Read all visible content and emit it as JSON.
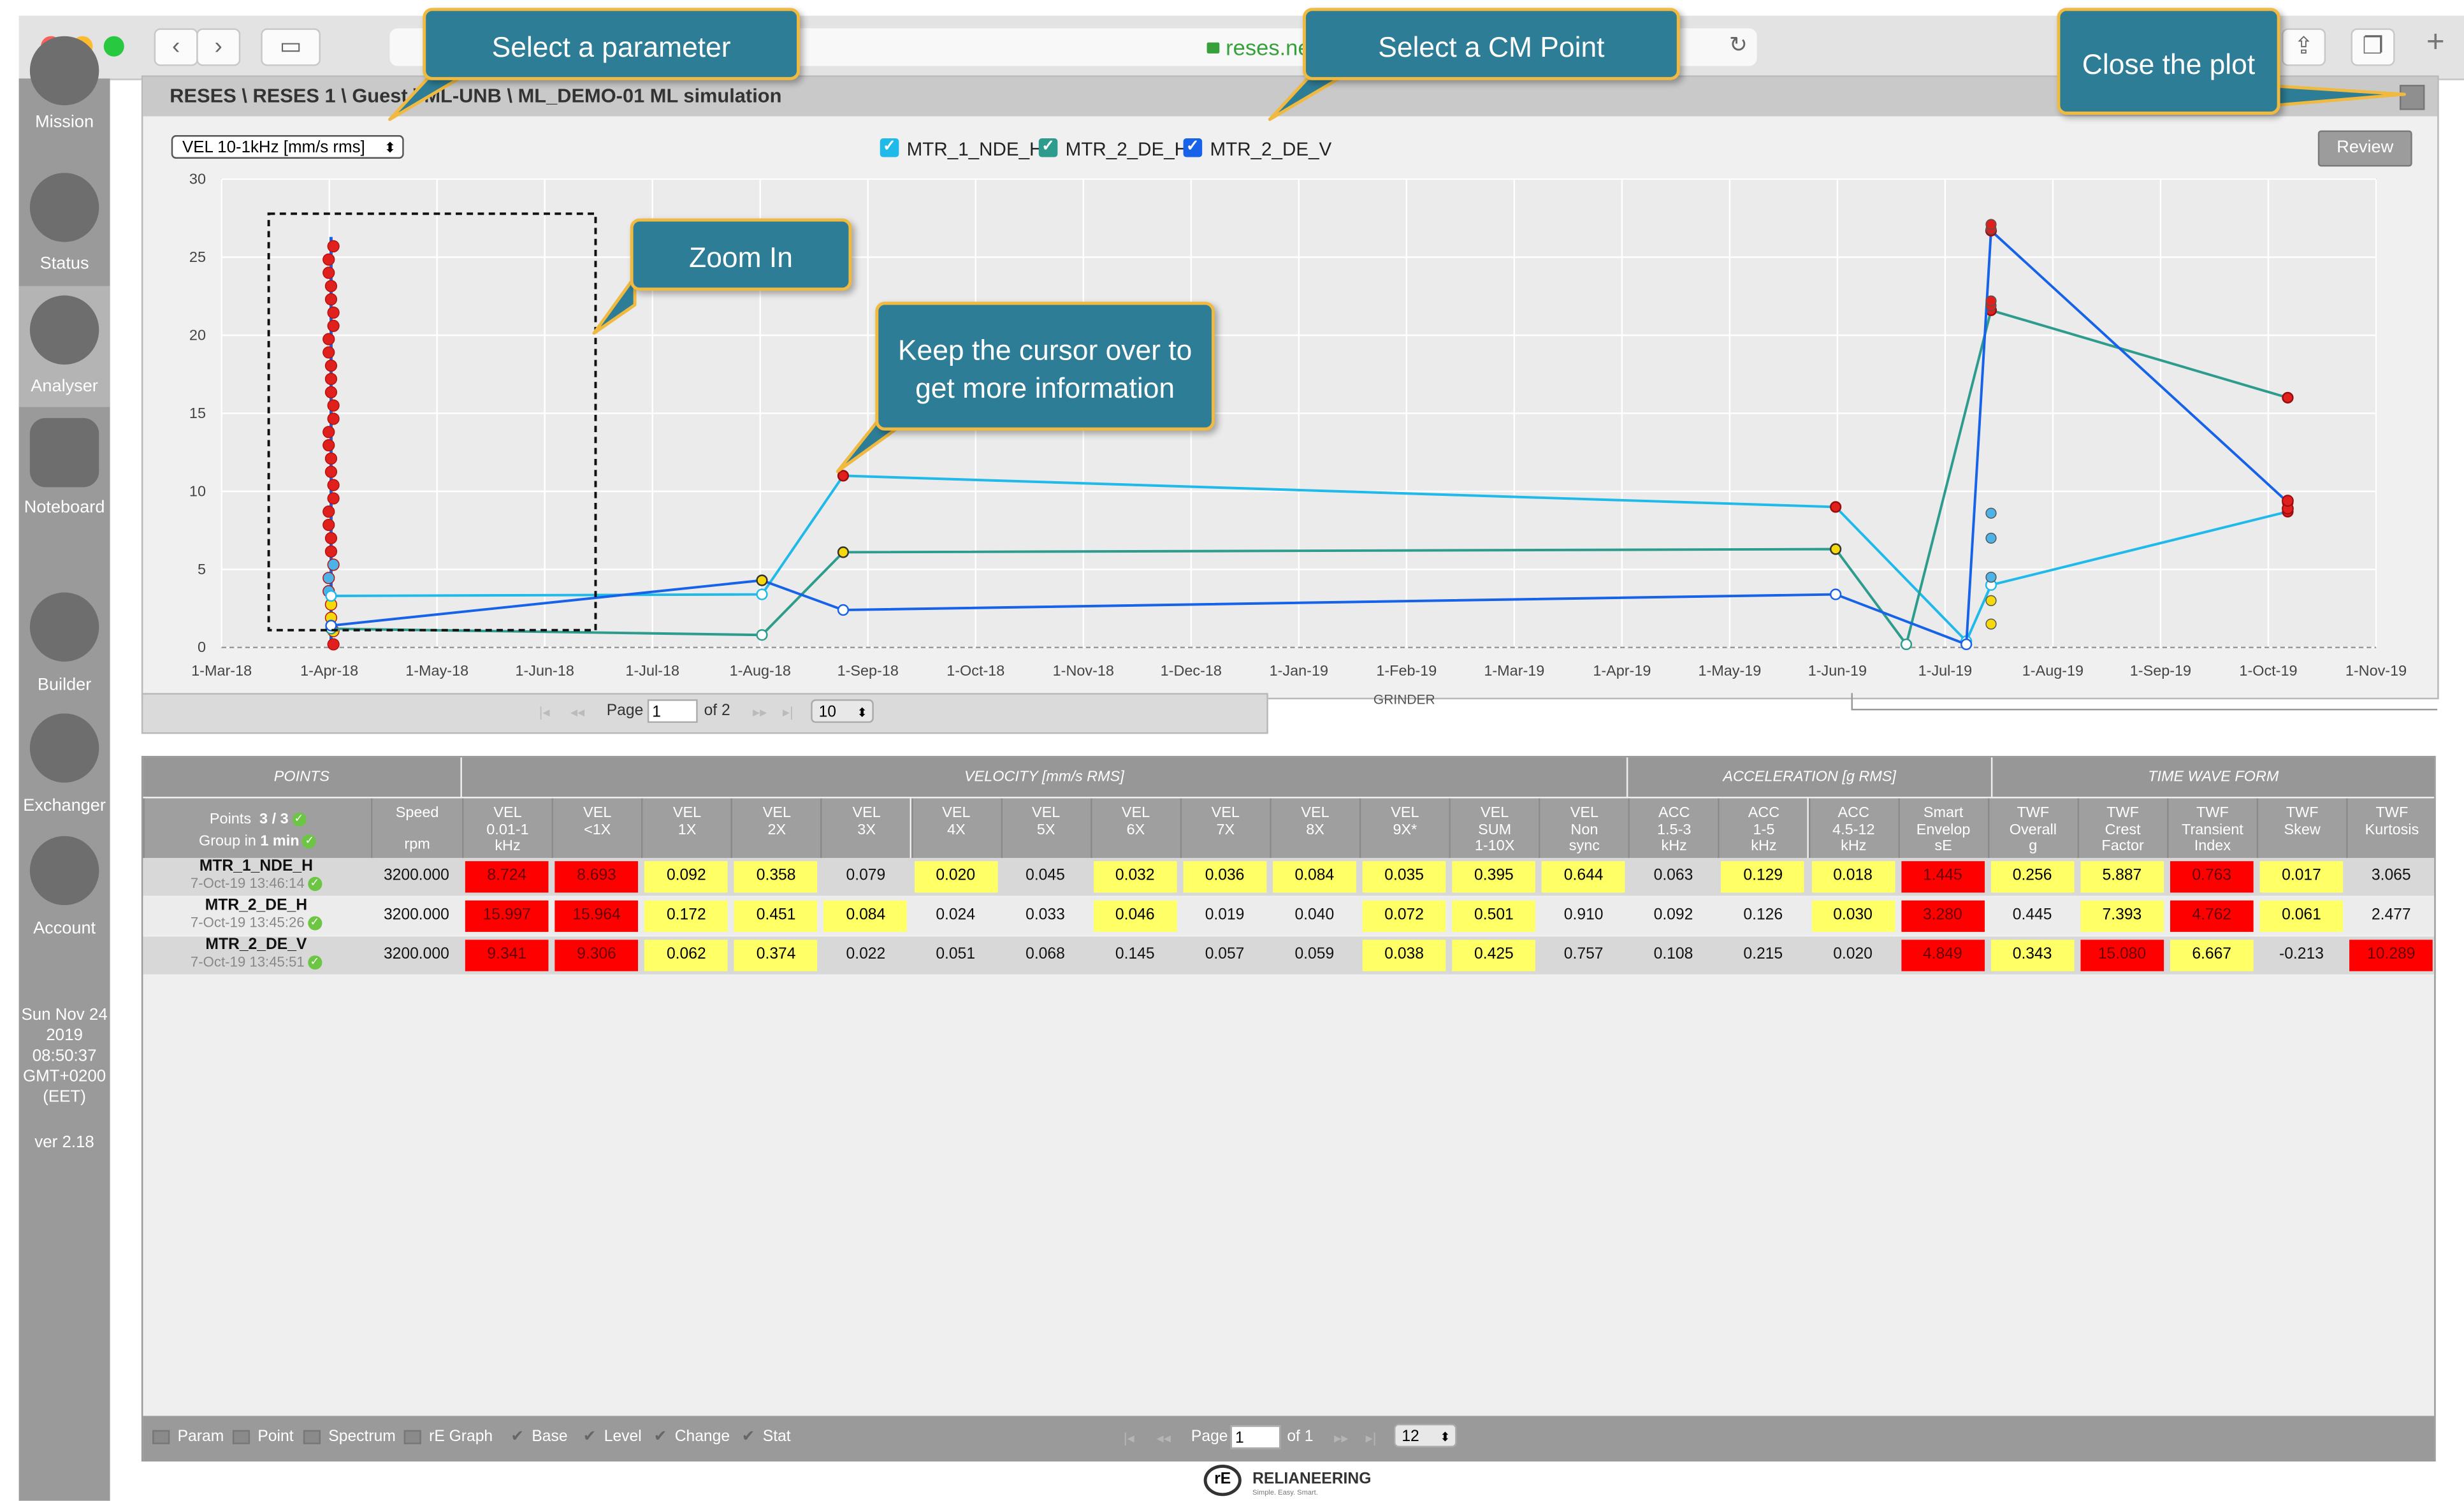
{
  "browser": {
    "url": "reses.net"
  },
  "sidebar": {
    "items": [
      {
        "label": "Mission"
      },
      {
        "label": "Status"
      },
      {
        "label": "Analyser"
      },
      {
        "label": "Noteboard"
      },
      {
        "label": "Builder"
      },
      {
        "label": "Exchanger"
      },
      {
        "label": "Account"
      }
    ],
    "date_lines": [
      "Sun Nov 24",
      "2019",
      "08:50:37",
      "GMT+0200",
      "(EET)"
    ],
    "version": "ver 2.18"
  },
  "panel": {
    "title": "RESES \\ RESES 1 \\ Guest \\ ML-UNB \\ ML_DEMO-01 ML simulation",
    "parameter": "VEL 10-1kHz [mm/s rms]",
    "review_label": "Review",
    "legend": [
      {
        "name": "MTR_1_NDE_H",
        "color": "#1fb9ea"
      },
      {
        "name": "MTR_2_DE_H",
        "color": "#2e9c8c"
      },
      {
        "name": "MTR_2_DE_V",
        "color": "#1662e8"
      }
    ],
    "footer_label": "GRINDER",
    "pager": {
      "page_label": "Page",
      "page": "1",
      "of_label": "of 2",
      "page_size": "10"
    }
  },
  "chart_data": {
    "type": "line",
    "title": "",
    "xlabel": "",
    "ylabel": "",
    "x_ticks": [
      "1-Mar-18",
      "1-Apr-18",
      "1-May-18",
      "1-Jun-18",
      "1-Jul-18",
      "1-Aug-18",
      "1-Sep-18",
      "1-Oct-18",
      "1-Nov-18",
      "1-Dec-18",
      "1-Jan-19",
      "1-Feb-19",
      "1-Mar-19",
      "1-Apr-19",
      "1-May-19",
      "1-Jun-19",
      "1-Jul-19",
      "1-Aug-19",
      "1-Sep-19",
      "1-Oct-19",
      "1-Nov-19"
    ],
    "y_ticks": [
      0,
      5,
      10,
      15,
      20,
      25,
      30
    ],
    "ylim": [
      0,
      30
    ],
    "grid": true,
    "legend_position": "top",
    "series": [
      {
        "name": "MTR_1_NDE_H",
        "color": "#1fb9ea",
        "points": [
          [
            "2018-04-01",
            3.3
          ],
          [
            "2018-08-01",
            3.4
          ],
          [
            "2018-08-24",
            11.0
          ],
          [
            "2019-06-01",
            9.0
          ],
          [
            "2019-07-08",
            0.4
          ],
          [
            "2019-07-15",
            4.0
          ],
          [
            "2019-10-07",
            8.7
          ]
        ]
      },
      {
        "name": "MTR_2_DE_H",
        "color": "#2e9c8c",
        "points": [
          [
            "2018-04-01",
            1.2
          ],
          [
            "2018-08-01",
            0.8
          ],
          [
            "2018-08-24",
            6.1
          ],
          [
            "2019-06-01",
            6.3
          ],
          [
            "2019-06-21",
            0.2
          ],
          [
            "2019-07-15",
            21.6
          ],
          [
            "2019-10-07",
            16.0
          ]
        ]
      },
      {
        "name": "MTR_2_DE_V",
        "color": "#1662e8",
        "points": [
          [
            "2018-04-01",
            1.4
          ],
          [
            "2018-08-01",
            4.3
          ],
          [
            "2018-08-24",
            2.4
          ],
          [
            "2019-06-01",
            3.4
          ],
          [
            "2019-07-08",
            0.2
          ],
          [
            "2019-07-15",
            26.7
          ],
          [
            "2019-10-07",
            9.3
          ]
        ]
      }
    ]
  },
  "table": {
    "groups": [
      "POINTS",
      "VELOCITY [mm/s RMS]",
      "ACCELERATION [g RMS]",
      "TIME WAVE FORM"
    ],
    "points_header": {
      "points_label": "Points",
      "points_count": "3 / 3",
      "group_label": "Group in",
      "group_value": "1 min"
    },
    "speed_header": [
      "Speed",
      "rpm"
    ],
    "columns": [
      [
        "VEL",
        "0.01-1",
        "kHz"
      ],
      [
        "VEL",
        "<1X",
        ""
      ],
      [
        "VEL",
        "1X",
        ""
      ],
      [
        "VEL",
        "2X",
        ""
      ],
      [
        "VEL",
        "3X",
        ""
      ],
      [
        "VEL",
        "4X",
        ""
      ],
      [
        "VEL",
        "5X",
        ""
      ],
      [
        "VEL",
        "6X",
        ""
      ],
      [
        "VEL",
        "7X",
        ""
      ],
      [
        "VEL",
        "8X",
        ""
      ],
      [
        "VEL",
        "9X*",
        ""
      ],
      [
        "VEL",
        "SUM",
        "1-10X"
      ],
      [
        "VEL",
        "Non",
        "sync"
      ],
      [
        "ACC",
        "1.5-3",
        "kHz"
      ],
      [
        "ACC",
        "1-5",
        "kHz"
      ],
      [
        "ACC",
        "4.5-12",
        "kHz"
      ],
      [
        "Smart",
        "Envelop",
        "sE"
      ],
      [
        "TWF",
        "Overall",
        "g"
      ],
      [
        "TWF",
        "Crest",
        "Factor"
      ],
      [
        "TWF",
        "Transient",
        "Index"
      ],
      [
        "TWF",
        "Skew",
        ""
      ],
      [
        "TWF",
        "Kurtosis",
        ""
      ]
    ],
    "rows": [
      {
        "name": "MTR_1_NDE_H",
        "date": "7-Oct-19 13:46:14",
        "speed": "3200.000",
        "values": [
          "8.724",
          "8.693",
          "0.092",
          "0.358",
          "0.079",
          "0.020",
          "0.045",
          "0.032",
          "0.036",
          "0.084",
          "0.035",
          "0.395",
          "0.644",
          "0.063",
          "0.129",
          "0.018",
          "1.445",
          "0.256",
          "5.887",
          "0.763",
          "0.017",
          "3.065"
        ],
        "status": [
          "r",
          "r",
          "y",
          "y",
          "n",
          "y",
          "n",
          "y",
          "y",
          "y",
          "y",
          "y",
          "y",
          "n",
          "y",
          "y",
          "r",
          "y",
          "y",
          "r",
          "y",
          "n"
        ]
      },
      {
        "name": "MTR_2_DE_H",
        "date": "7-Oct-19 13:45:26",
        "speed": "3200.000",
        "values": [
          "15.997",
          "15.964",
          "0.172",
          "0.451",
          "0.084",
          "0.024",
          "0.033",
          "0.046",
          "0.019",
          "0.040",
          "0.072",
          "0.501",
          "0.910",
          "0.092",
          "0.126",
          "0.030",
          "3.280",
          "0.445",
          "7.393",
          "4.762",
          "0.061",
          "2.477"
        ],
        "status": [
          "r",
          "r",
          "y",
          "y",
          "y",
          "n",
          "n",
          "y",
          "n",
          "n",
          "y",
          "y",
          "n",
          "n",
          "n",
          "y",
          "r",
          "n",
          "y",
          "r",
          "y",
          "n"
        ]
      },
      {
        "name": "MTR_2_DE_V",
        "date": "7-Oct-19 13:45:51",
        "speed": "3200.000",
        "values": [
          "9.341",
          "9.306",
          "0.062",
          "0.374",
          "0.022",
          "0.051",
          "0.068",
          "0.145",
          "0.057",
          "0.059",
          "0.038",
          "0.425",
          "0.757",
          "0.108",
          "0.215",
          "0.020",
          "4.849",
          "0.343",
          "15.080",
          "6.667",
          "-0.213",
          "10.289"
        ],
        "status": [
          "r",
          "r",
          "y",
          "y",
          "n",
          "n",
          "n",
          "n",
          "n",
          "n",
          "y",
          "y",
          "n",
          "n",
          "n",
          "n",
          "r",
          "y",
          "r",
          "y",
          "n",
          "r"
        ]
      }
    ],
    "toolbar": {
      "items": [
        "Param",
        "Point",
        "Spectrum",
        "rE Graph"
      ],
      "checks": [
        "Base",
        "Level",
        "Change",
        "Stat"
      ],
      "page_label": "Page",
      "page": "1",
      "of_label": "of 1",
      "page_size": "12"
    }
  },
  "branding": {
    "name": "RELIANEERING",
    "tagline": "Simple. Easy. Smart."
  },
  "callouts": {
    "parameter": "Select a parameter",
    "cm_point": "Select a CM Point",
    "close": "Close the plot",
    "zoom": "Zoom In",
    "cursor": "Keep the cursor over to get more information"
  }
}
